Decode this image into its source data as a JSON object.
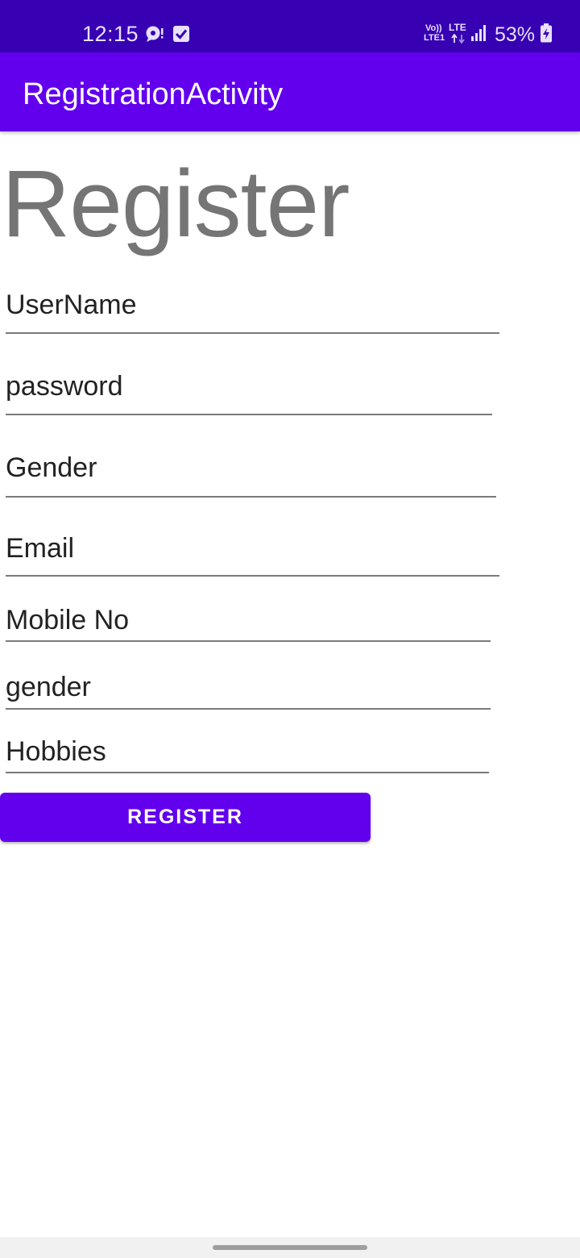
{
  "status_bar": {
    "time": "12:15",
    "network_label_top": "Vo))",
    "network_label_bottom": "LTE1",
    "lte_label": "LTE",
    "battery_percent": "53%",
    "icons": [
      "chat-bubble-icon",
      "checkbox-icon",
      "signal-icon",
      "battery-charging-icon"
    ]
  },
  "app_bar": {
    "title": "RegistrationActivity"
  },
  "form": {
    "heading": "Register",
    "fields": {
      "username": "UserName",
      "password": "password",
      "gender": "Gender",
      "email": "Email",
      "mobile": "Mobile No",
      "gender2": "gender",
      "hobbies": "Hobbies"
    },
    "register_button": "REGISTER"
  },
  "colors": {
    "status_bar": "#3700b3",
    "app_bar": "#6200ee",
    "button": "#6200ee",
    "heading_text": "#757575"
  }
}
